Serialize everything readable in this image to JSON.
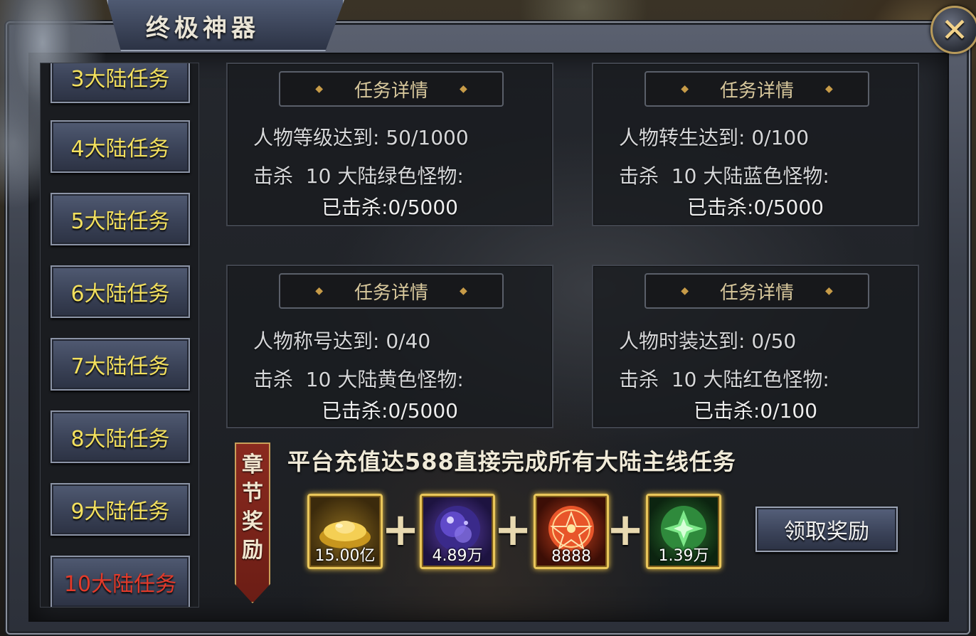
{
  "window": {
    "title": "终极神器"
  },
  "tasks": [
    {
      "label": "3大陆任务",
      "active": false
    },
    {
      "label": "4大陆任务",
      "active": false
    },
    {
      "label": "5大陆任务",
      "active": false
    },
    {
      "label": "6大陆任务",
      "active": false
    },
    {
      "label": "7大陆任务",
      "active": false
    },
    {
      "label": "8大陆任务",
      "active": false
    },
    {
      "label": "9大陆任务",
      "active": false
    },
    {
      "label": "10大陆任务",
      "active": true
    }
  ],
  "panels": [
    {
      "header": "任务详情",
      "line1": "人物等级达到: 50/1000",
      "line2": "击杀  10 大陆绿色怪物:",
      "progress": "已击杀:0/5000"
    },
    {
      "header": "任务详情",
      "line1": "人物转生达到: 0/100",
      "line2": "击杀  10 大陆蓝色怪物:",
      "progress": "已击杀:0/5000"
    },
    {
      "header": "任务详情",
      "line1": "人物称号达到: 0/40",
      "line2": "击杀  10 大陆黄色怪物:",
      "progress": "已击杀:0/5000"
    },
    {
      "header": "任务详情",
      "line1": "人物时装达到: 0/50",
      "line2": "击杀  10 大陆红色怪物:",
      "progress": "已击杀:0/100"
    }
  ],
  "rewards": {
    "chapter_label": [
      "章",
      "节",
      "奖",
      "励"
    ],
    "heading": "平台充值达588直接完成所有大陆主线任务",
    "items": [
      {
        "icon": "gold-ingot-icon",
        "quantity": "15.00亿"
      },
      {
        "icon": "purple-orb-icon",
        "quantity": "4.89万"
      },
      {
        "icon": "red-pentagram-icon",
        "quantity": "8888"
      },
      {
        "icon": "green-crystal-icon",
        "quantity": "1.39万"
      }
    ],
    "plus_sign": "+",
    "claim_label": "领取奖励"
  },
  "close_symbol": "✕"
}
